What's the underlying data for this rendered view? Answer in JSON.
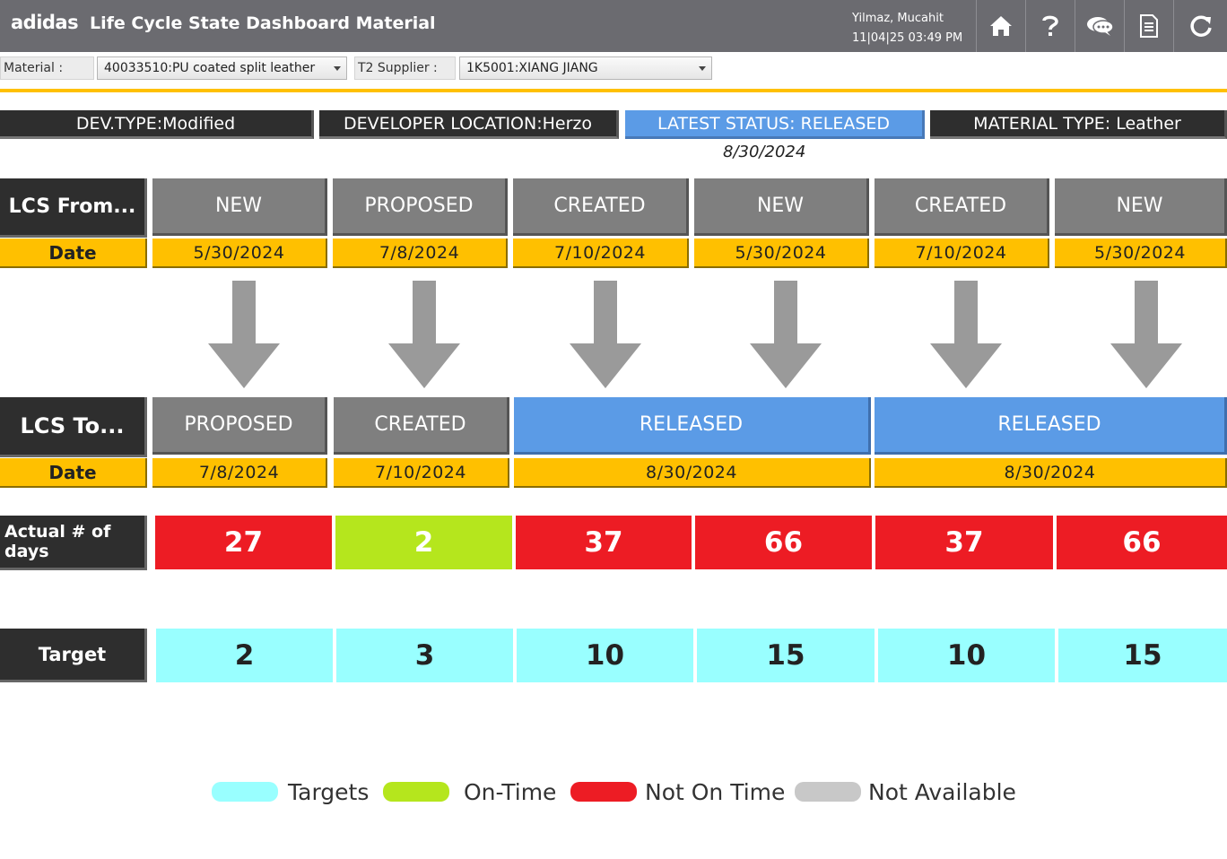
{
  "header": {
    "brand": "adidas",
    "title": "Life Cycle State Dashboard Material",
    "user": "Yilmaz, Mucahit",
    "datetime": "11|04|25 03:49 PM",
    "icons": [
      "home-icon",
      "help-icon",
      "chat-icon",
      "document-icon",
      "refresh-icon"
    ]
  },
  "filters": {
    "material_label": "Material :",
    "material_value": "40033510:PU coated split leather",
    "supplier_label": "T2 Supplier :",
    "supplier_value": "1K5001:XIANG JIANG"
  },
  "info": {
    "dev_type": "DEV.TYPE:Modified",
    "developer_location": "DEVELOPER LOCATION:Herzo",
    "latest_status": "LATEST STATUS: RELEASED",
    "latest_status_date": "8/30/2024",
    "material_type": "MATERIAL TYPE: Leather"
  },
  "labels": {
    "lcs_from": "LCS From...",
    "lcs_to": "LCS To...",
    "date": "Date",
    "actual_days": "Actual # of days",
    "target": "Target"
  },
  "from_states": [
    {
      "state": "NEW",
      "date": "5/30/2024"
    },
    {
      "state": "PROPOSED",
      "date": "7/8/2024"
    },
    {
      "state": "CREATED",
      "date": "7/10/2024"
    },
    {
      "state": "NEW",
      "date": "5/30/2024"
    },
    {
      "state": "CREATED",
      "date": "7/10/2024"
    },
    {
      "state": "NEW",
      "date": "5/30/2024"
    }
  ],
  "to_states": [
    {
      "state": "PROPOSED",
      "date": "7/8/2024"
    },
    {
      "state": "CREATED",
      "date": "7/10/2024"
    },
    {
      "state": "RELEASED",
      "date": "8/30/2024"
    },
    {
      "state": "RELEASED",
      "date": "8/30/2024"
    }
  ],
  "actual_days": [
    {
      "value": "27",
      "status": "Not On Time"
    },
    {
      "value": "2",
      "status": "On-Time"
    },
    {
      "value": "37",
      "status": "Not On Time"
    },
    {
      "value": "66",
      "status": "Not On Time"
    },
    {
      "value": "37",
      "status": "Not On Time"
    },
    {
      "value": "66",
      "status": "Not On Time"
    }
  ],
  "targets": [
    "2",
    "3",
    "10",
    "15",
    "10",
    "15"
  ],
  "legend": [
    {
      "label": "Targets",
      "color": "#99ffff"
    },
    {
      "label": "On-Time",
      "color": "#b5e61d"
    },
    {
      "label": "Not On Time",
      "color": "#ed1c24"
    },
    {
      "label": "Not Available",
      "color": "#c8c8c8"
    }
  ],
  "colors": {
    "header": "#6b6b70",
    "accent_yellow": "#ffc000",
    "state_grey": "#7f7f7f",
    "state_blue": "#5b9be6",
    "dark": "#2e2e2e"
  }
}
